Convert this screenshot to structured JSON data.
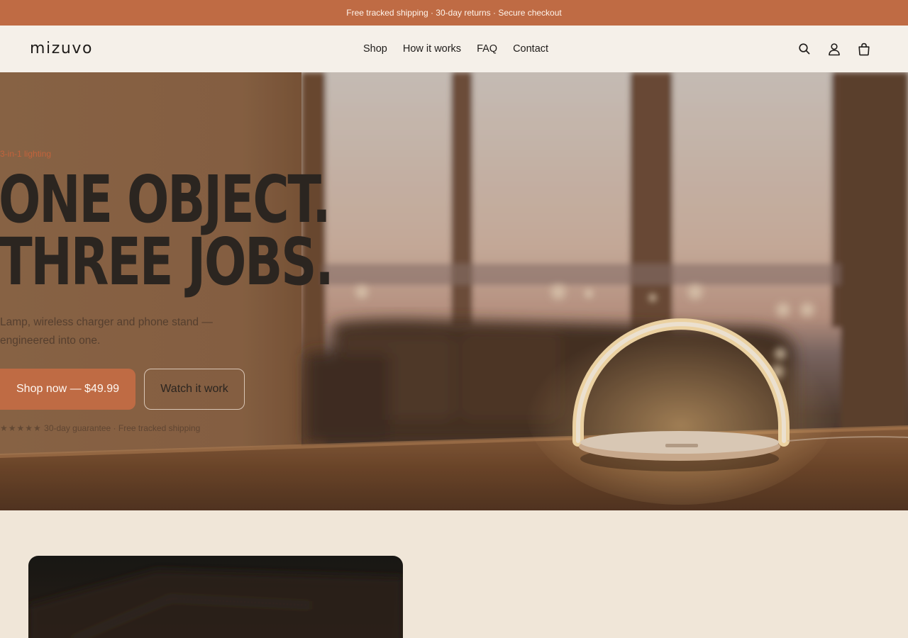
{
  "announcement": "Free tracked shipping · 30-day returns · Secure checkout",
  "header": {
    "logo": "mizuvo",
    "nav": [
      "Shop",
      "How it works",
      "FAQ",
      "Contact"
    ],
    "icons": [
      "search-icon",
      "account-icon",
      "cart-icon"
    ]
  },
  "hero": {
    "eyebrow": "3-in-1 lighting",
    "headline_line1": "ONE OBJECT.",
    "headline_line2": "THREE JOBS.",
    "subtitle": "Lamp, wireless charger and phone stand — engineered into one.",
    "primary_cta": "Shop now — $49.99",
    "secondary_cta": "Watch it work",
    "trust_stars": "★★★★★",
    "trust_text": "30-day guarantee · Free tracked shipping"
  },
  "colors": {
    "accent": "#bf6b44",
    "header_bg": "#f5f0e9",
    "page_bg": "#f0e6d8",
    "text_dark": "#2b2520"
  }
}
